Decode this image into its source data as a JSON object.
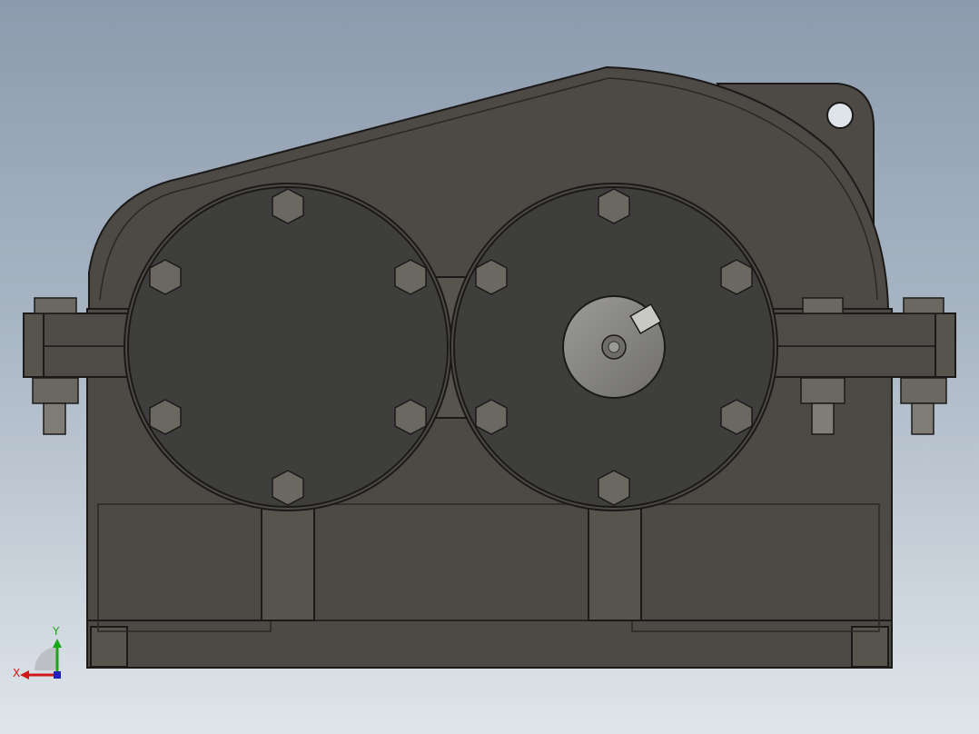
{
  "triad": {
    "x_label": "X",
    "y_label": "Y"
  },
  "colors": {
    "housing": "#4d4944",
    "housing_edge": "#1c1a18",
    "cover": "#3e3f3c",
    "bolt": "#6b6761",
    "hub": "#8a8986",
    "axis_x": "#d01818",
    "axis_y": "#17a817",
    "axis_z": "#2020c0"
  }
}
